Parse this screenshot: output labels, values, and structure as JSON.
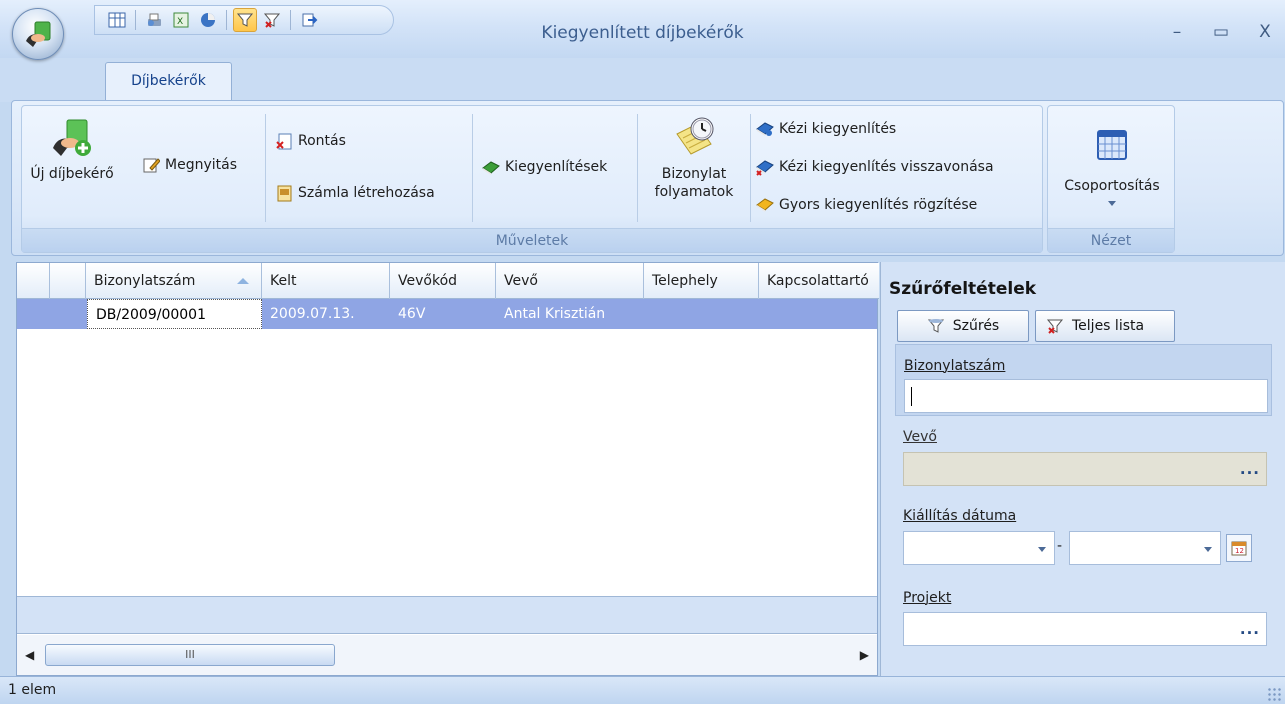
{
  "window": {
    "title": "Kiegyenlített díjbekérők",
    "minimize": "–",
    "maximize": "▭",
    "close": "X"
  },
  "quick_access_icons": [
    "table-icon",
    "print-preview-icon",
    "excel-icon",
    "chart-icon",
    "filter-icon",
    "clear-filter-icon",
    "export-icon"
  ],
  "ribbon": {
    "tab": "Díjbekérők",
    "groups": {
      "muveletek": "Műveletek",
      "nezet": "Nézet"
    },
    "buttons": {
      "new": "Új díjbekérő",
      "open": "Megnyitás",
      "spoil": "Rontás",
      "create_invoice": "Számla létrehozása",
      "settlements": "Kiegyenlítések",
      "doc_process_1": "Bizonylat",
      "doc_process_2": "folyamatok",
      "manual_settle": "Kézi kiegyenlítés",
      "manual_settle_revoke": "Kézi kiegyenlítés visszavonása",
      "quick_settle": "Gyors kiegyenlítés rögzítése",
      "grouping": "Csoportosítás"
    }
  },
  "grid": {
    "columns": [
      "Bizonylatszám",
      "Kelt",
      "Vevőkód",
      "Vevő",
      "Telephely",
      "Kapcsolattartó"
    ],
    "rows": [
      [
        "DB/2009/00001",
        "2009.07.13.",
        "46V",
        "Antal Krisztián",
        "",
        ""
      ]
    ],
    "scroll_thumb": "III"
  },
  "filter": {
    "title": "Szűrőfeltételek",
    "filter_button": "Szűrés",
    "full_list_button": "Teljes lista",
    "doc_number_label": "Bizonylatszám",
    "doc_number_value": "",
    "customer_label": "Vevő",
    "customer_value": "",
    "issue_date_label": "Kiállítás dátuma",
    "date_from": "",
    "date_sep": "-",
    "date_to": "",
    "project_label": "Projekt",
    "project_value": "",
    "ellipsis": "..."
  },
  "status": {
    "count": "1 elem"
  },
  "colors": {
    "selected_row": "#8fa5e4",
    "ribbon_bg": "#dbe8f9",
    "title_text": "#3c5e8f"
  }
}
